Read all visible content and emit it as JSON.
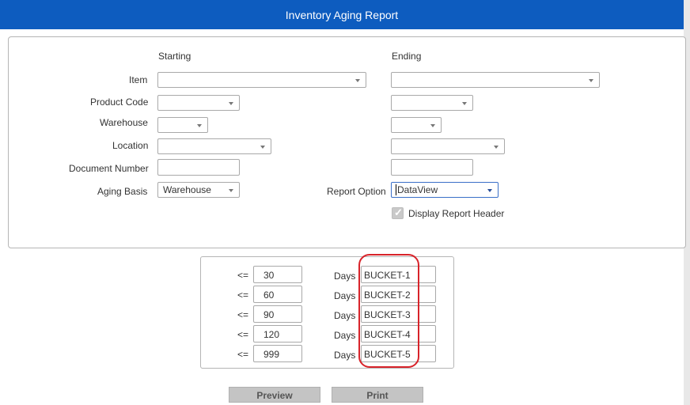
{
  "header": {
    "title": "Inventory Aging Report"
  },
  "columns": {
    "starting": "Starting",
    "ending": "Ending"
  },
  "fields": {
    "item": {
      "label": "Item",
      "start": "",
      "end": ""
    },
    "product_code": {
      "label": "Product Code",
      "start": "",
      "end": ""
    },
    "warehouse": {
      "label": "Warehouse",
      "start": "",
      "end": ""
    },
    "location": {
      "label": "Location",
      "start": "",
      "end": ""
    },
    "document_number": {
      "label": "Document Number",
      "start": "",
      "end": ""
    },
    "aging_basis": {
      "label": "Aging Basis",
      "value": "Warehouse"
    },
    "report_option": {
      "label": "Report Option",
      "value": "DataView"
    },
    "display_header": {
      "label": "Display Report Header",
      "checked": true
    }
  },
  "buckets": [
    {
      "op": "<=",
      "days": "30",
      "days_label": "Days",
      "name": "BUCKET-1"
    },
    {
      "op": "<=",
      "days": "60",
      "days_label": "Days",
      "name": "BUCKET-2"
    },
    {
      "op": "<=",
      "days": "90",
      "days_label": "Days",
      "name": "BUCKET-3"
    },
    {
      "op": "<=",
      "days": "120",
      "days_label": "Days",
      "name": "BUCKET-4"
    },
    {
      "op": "<=",
      "days": "999",
      "days_label": "Days",
      "name": "BUCKET-5"
    }
  ],
  "actions": {
    "preview": "Preview",
    "print": "Print"
  },
  "colors": {
    "header_bg": "#0d5cbf",
    "highlight": "#d8232a",
    "button_bg": "#c4c4c4"
  },
  "icons": {
    "dropdown": "chevron-down-icon",
    "checkbox": "checkmark-icon"
  }
}
